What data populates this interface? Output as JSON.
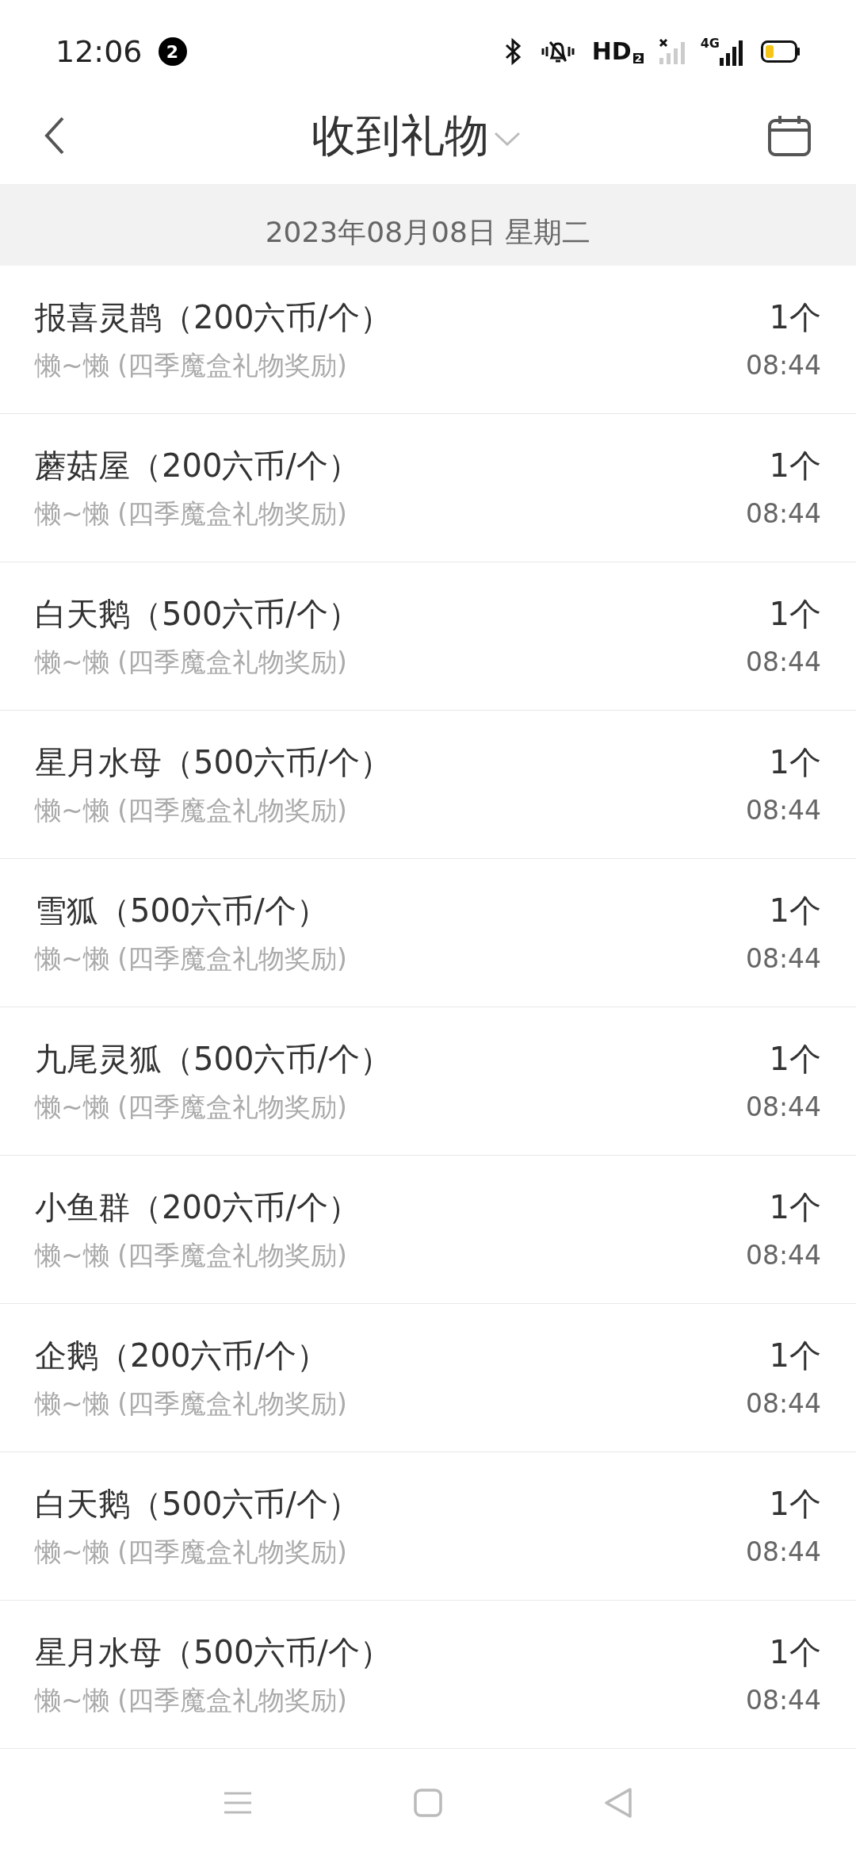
{
  "status_bar": {
    "time": "12:06",
    "notification_count": "2",
    "network": "HD",
    "sim_badge": "2",
    "network_type": "4G"
  },
  "header": {
    "title": "收到礼物"
  },
  "date_header": "2023年08月08日 星期二",
  "gifts": [
    {
      "name": "报喜灵鹊（200六币/个）",
      "source": "懒~懒 (四季魔盒礼物奖励)",
      "quantity": "1个",
      "time": "08:44"
    },
    {
      "name": "蘑菇屋（200六币/个）",
      "source": "懒~懒 (四季魔盒礼物奖励)",
      "quantity": "1个",
      "time": "08:44"
    },
    {
      "name": "白天鹅（500六币/个）",
      "source": "懒~懒 (四季魔盒礼物奖励)",
      "quantity": "1个",
      "time": "08:44"
    },
    {
      "name": "星月水母（500六币/个）",
      "source": "懒~懒 (四季魔盒礼物奖励)",
      "quantity": "1个",
      "time": "08:44"
    },
    {
      "name": "雪狐（500六币/个）",
      "source": "懒~懒 (四季魔盒礼物奖励)",
      "quantity": "1个",
      "time": "08:44"
    },
    {
      "name": "九尾灵狐（500六币/个）",
      "source": "懒~懒 (四季魔盒礼物奖励)",
      "quantity": "1个",
      "time": "08:44"
    },
    {
      "name": "小鱼群（200六币/个）",
      "source": "懒~懒 (四季魔盒礼物奖励)",
      "quantity": "1个",
      "time": "08:44"
    },
    {
      "name": "企鹅（200六币/个）",
      "source": "懒~懒 (四季魔盒礼物奖励)",
      "quantity": "1个",
      "time": "08:44"
    },
    {
      "name": "白天鹅（500六币/个）",
      "source": "懒~懒 (四季魔盒礼物奖励)",
      "quantity": "1个",
      "time": "08:44"
    },
    {
      "name": "星月水母（500六币/个）",
      "source": "懒~懒 (四季魔盒礼物奖励)",
      "quantity": "1个",
      "time": "08:44"
    }
  ]
}
